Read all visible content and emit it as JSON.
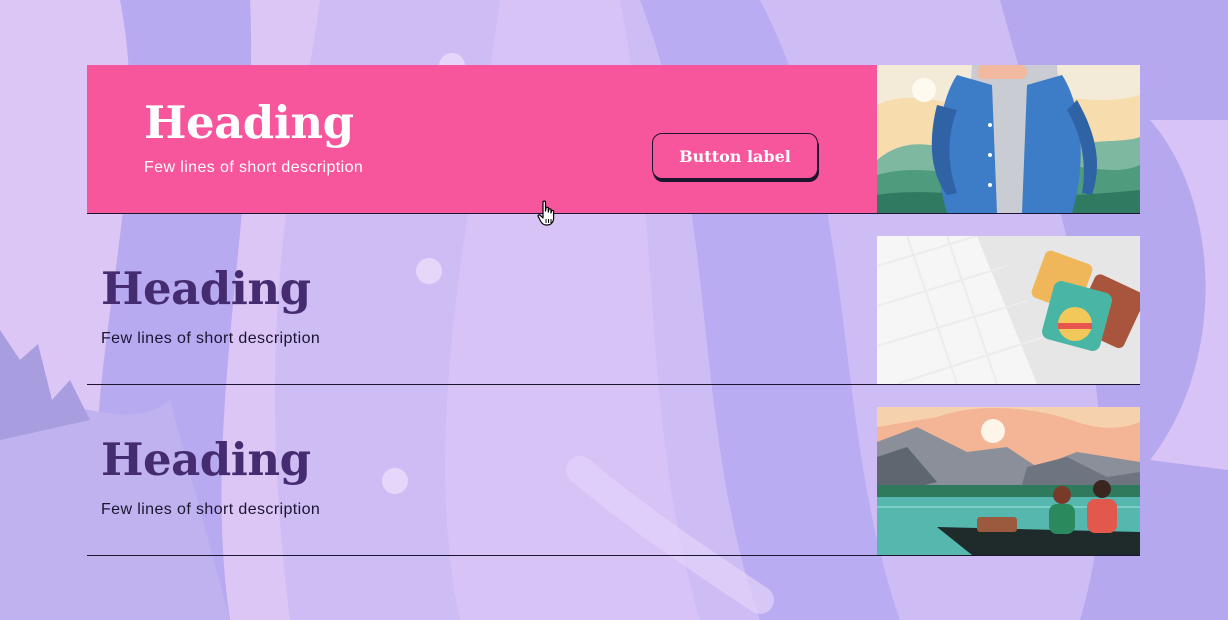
{
  "rows": [
    {
      "heading": "Heading",
      "description": "Few lines of short description",
      "button_label": "Button label",
      "image": "man-in-denim-jacket-illustration"
    },
    {
      "heading": "Heading",
      "description": "Few lines of short description",
      "image": "folded-shirts-illustration"
    },
    {
      "heading": "Heading",
      "description": "Few lines of short description",
      "image": "couple-in-boat-at-lake-illustration"
    }
  ],
  "colors": {
    "accent": "#f7559c",
    "heading": "#452c70",
    "background": "#c7b9f2"
  }
}
